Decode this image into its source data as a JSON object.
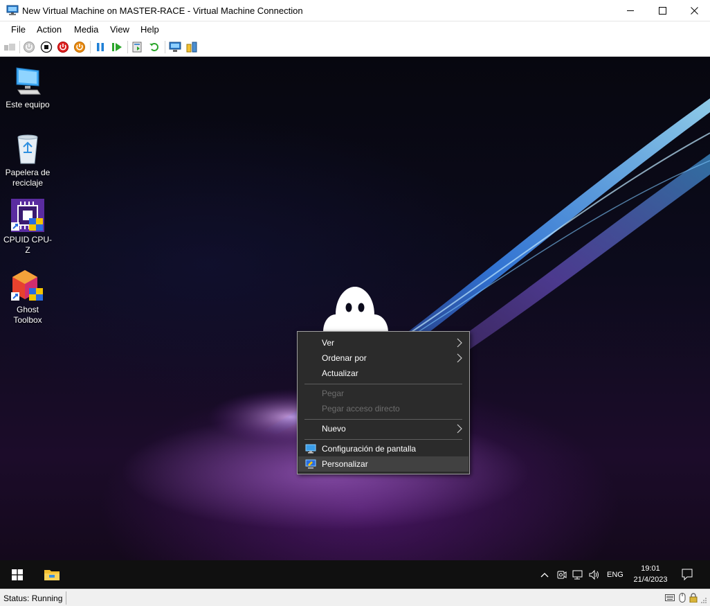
{
  "window": {
    "title": "New Virtual Machine on MASTER-RACE - Virtual Machine Connection",
    "minimize_icon": "minimize-icon",
    "maximize_icon": "maximize-icon",
    "close_icon": "close-icon"
  },
  "menu": {
    "items": [
      {
        "label": "File"
      },
      {
        "label": "Action"
      },
      {
        "label": "Media"
      },
      {
        "label": "View"
      },
      {
        "label": "Help"
      }
    ]
  },
  "toolbar": {
    "buttons": [
      {
        "icon": "ctrl-alt-del-icon"
      },
      {
        "icon": "start-icon"
      },
      {
        "icon": "turn-off-icon"
      },
      {
        "icon": "shut-down-icon"
      },
      {
        "icon": "power-icon"
      },
      {
        "icon": "pause-icon"
      },
      {
        "icon": "resume-icon"
      },
      {
        "icon": "checkpoint-icon"
      },
      {
        "icon": "revert-icon"
      },
      {
        "icon": "enhanced-session-icon"
      },
      {
        "icon": "share-icon"
      }
    ]
  },
  "desktop": {
    "icons": [
      {
        "label": "Este equipo",
        "icon": "computer-icon"
      },
      {
        "label": "Papelera de reciclaje",
        "icon": "recycle-bin-icon"
      },
      {
        "label": "CPUID CPU-Z",
        "icon": "cpuz-icon"
      },
      {
        "label": "Ghost Toolbox",
        "icon": "ghost-toolbox-icon"
      }
    ]
  },
  "context_menu": {
    "items": [
      {
        "label": "Ver",
        "has_submenu": true,
        "enabled": true
      },
      {
        "label": "Ordenar por",
        "has_submenu": true,
        "enabled": true
      },
      {
        "label": "Actualizar",
        "has_submenu": false,
        "enabled": true
      },
      {
        "label": "Pegar",
        "has_submenu": false,
        "enabled": false
      },
      {
        "label": "Pegar acceso directo",
        "has_submenu": false,
        "enabled": false
      },
      {
        "label": "Nuevo",
        "has_submenu": true,
        "enabled": true
      },
      {
        "label": "Configuración de pantalla",
        "icon": "display-settings-icon",
        "enabled": true
      },
      {
        "label": "Personalizar",
        "icon": "personalize-icon",
        "enabled": true,
        "highlighted": true
      }
    ]
  },
  "taskbar": {
    "start_icon": "windows-start-icon",
    "pinned": [
      {
        "icon": "file-explorer-icon"
      }
    ],
    "tray": {
      "language": "ENG",
      "time": "19:01",
      "date": "21/4/2023"
    }
  },
  "statusbar": {
    "status": "Status: Running"
  },
  "colors": {
    "taskbar": "#101010",
    "menu_bg": "#2b2b2b",
    "menu_highlight": "#414141",
    "disabled_text": "#6d6d6d"
  }
}
